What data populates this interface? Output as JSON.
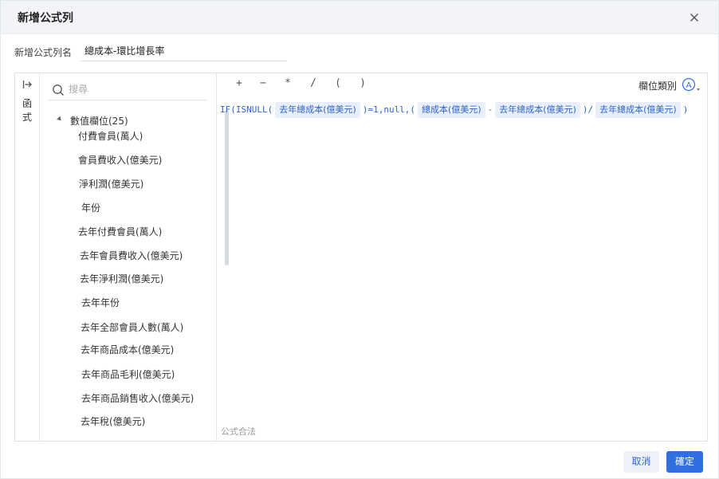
{
  "dialog": {
    "title": "新增公式列",
    "close_icon": "close-icon"
  },
  "name_field": {
    "label": "新增公式列名",
    "value": "總成本-環比增長率"
  },
  "rail": {
    "arrow_icon": "expand-arrow-icon",
    "tab_label": "函式"
  },
  "fields": {
    "search_placeholder": "搜尋",
    "group_label": "數值欄位(25)",
    "items": [
      "付費會員(萬人)",
      "會員費收入(億美元)",
      "淨利潤(億美元)",
      "年份",
      "去年付費會員(萬人)",
      "去年會員費收入(億美元)",
      "去年淨利潤(億美元)",
      "去年年份",
      "去年全部會員人數(萬人)",
      "去年商品成本(億美元)",
      "去年商品毛利(億美元)",
      "去年商品銷售收入(億美元)",
      "去年稅(億美元)"
    ]
  },
  "toolbar": {
    "ops": [
      "+",
      "−",
      "*",
      "/",
      "(",
      ")"
    ],
    "type_label": "欄位類別",
    "type_icon": "A"
  },
  "formula": {
    "t1": "IF(ISNULL(",
    "c1": "去年總成本(億美元)",
    "t2": ")=1,null,(",
    "c2": "總成本(億美元)",
    "t3": "-",
    "c3": "去年總成本(億美元)",
    "t4": ")/",
    "c4": "去年總成本(億美元)",
    "t5": ")"
  },
  "status": "公式合法",
  "buttons": {
    "cancel": "取消",
    "ok": "確定"
  },
  "colors": {
    "accent": "#2f6fe0",
    "chip_bg": "#e8effb",
    "header_bg": "#f2f4f7"
  }
}
